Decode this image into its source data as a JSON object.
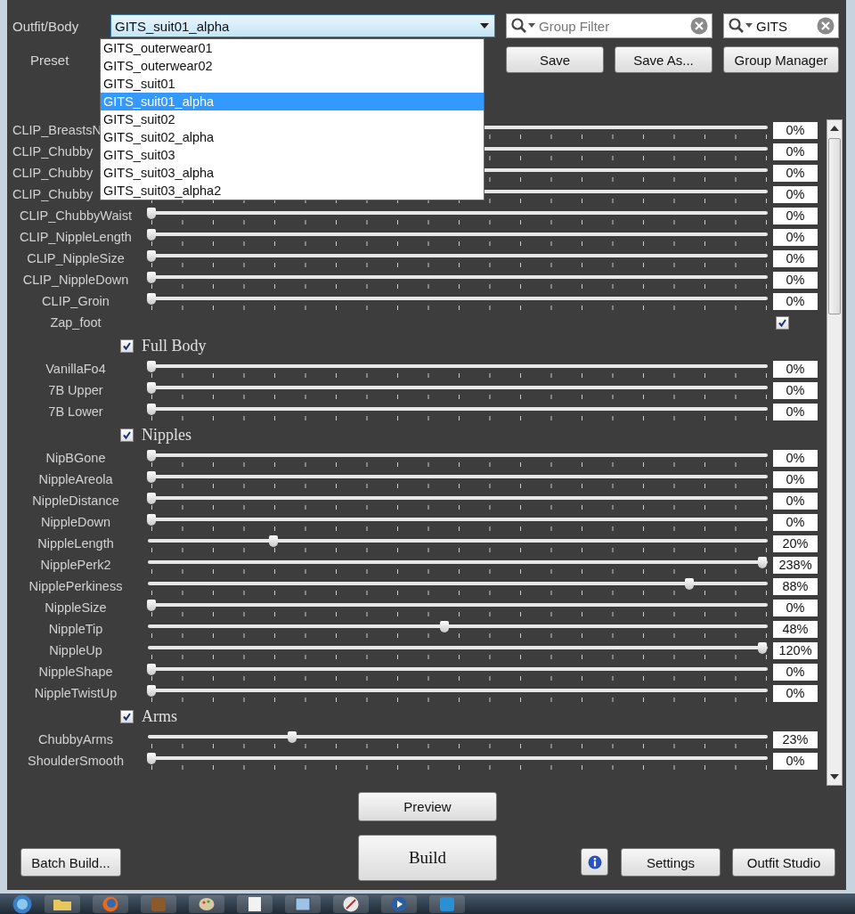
{
  "outfit_body": {
    "label": "Outfit/Body",
    "value": "GITS_suit01_alpha"
  },
  "group_filter": {
    "placeholder": "Group Filter"
  },
  "outfit_filter": {
    "value": "GITS"
  },
  "preset": {
    "label": "Preset"
  },
  "preset_buttons": [
    "Save",
    "Save As...",
    "Group Manager"
  ],
  "dropdown": [
    {
      "label": "GITS_outerwear01",
      "selected": false
    },
    {
      "label": "GITS_outerwear02",
      "selected": false
    },
    {
      "label": "GITS_suit01",
      "selected": false
    },
    {
      "label": "GITS_suit01_alpha",
      "selected": true
    },
    {
      "label": "GITS_suit02",
      "selected": false
    },
    {
      "label": "GITS_suit02_alpha",
      "selected": false
    },
    {
      "label": "GITS_suit03",
      "selected": false
    },
    {
      "label": "GITS_suit03_alpha",
      "selected": false
    },
    {
      "label": "GITS_suit03_alpha2",
      "selected": false
    }
  ],
  "sliders": [
    {
      "kind": "partial",
      "label": "CLIP_BreastsN",
      "level": 0,
      "reading": "0%"
    },
    {
      "kind": "partial",
      "label": "CLIP_Chubby",
      "level": 0,
      "reading": "0%"
    },
    {
      "kind": "partial",
      "label": "CLIP_Chubby",
      "level": 0,
      "reading": "0%"
    },
    {
      "kind": "partial",
      "label": "CLIP_Chubby",
      "level": 0,
      "reading": "0%"
    },
    {
      "kind": "slider",
      "label": "CLIP_ChubbyWaist",
      "level": 0,
      "reading": "0%"
    },
    {
      "kind": "slider",
      "label": "CLIP_NippleLength",
      "level": 0,
      "reading": "0%"
    },
    {
      "kind": "slider",
      "label": "CLIP_NippleSize",
      "level": 0,
      "reading": "0%"
    },
    {
      "kind": "slider",
      "label": "CLIP_NippleDown",
      "level": 0,
      "reading": "0%"
    },
    {
      "kind": "slider",
      "label": "CLIP_Groin",
      "level": 0,
      "reading": "0%"
    },
    {
      "kind": "checkbox",
      "label": "Zap_foot",
      "checked": true
    },
    {
      "kind": "group",
      "label": "Full Body",
      "checked": true
    },
    {
      "kind": "slider",
      "label": "VanillaFo4",
      "level": 0,
      "reading": "0%"
    },
    {
      "kind": "slider",
      "label": "7B Upper",
      "level": 0,
      "reading": "0%"
    },
    {
      "kind": "slider",
      "label": "7B Lower",
      "level": 0,
      "reading": "0%"
    },
    {
      "kind": "group",
      "label": "Nipples",
      "checked": true
    },
    {
      "kind": "slider",
      "label": "NipBGone",
      "level": 0,
      "reading": "0%"
    },
    {
      "kind": "slider",
      "label": "NippleAreola",
      "level": 0,
      "reading": "0%"
    },
    {
      "kind": "slider",
      "label": "NippleDistance",
      "level": 0,
      "reading": "0%"
    },
    {
      "kind": "slider",
      "label": "NippleDown",
      "level": 0,
      "reading": "0%"
    },
    {
      "kind": "slider",
      "label": "NippleLength",
      "level": 0.2,
      "reading": "20%"
    },
    {
      "kind": "slider",
      "label": "NipplePerk2",
      "level": 1,
      "reading": "238%"
    },
    {
      "kind": "slider",
      "label": "NipplePerkiness",
      "level": 0.88,
      "reading": "88%"
    },
    {
      "kind": "slider",
      "label": "NippleSize",
      "level": 0,
      "reading": "0%"
    },
    {
      "kind": "slider",
      "label": "NippleTip",
      "level": 0.48,
      "reading": "48%"
    },
    {
      "kind": "slider",
      "label": "NippleUp",
      "level": 1,
      "reading": "120%"
    },
    {
      "kind": "slider",
      "label": "NippleShape",
      "level": 0,
      "reading": "0%"
    },
    {
      "kind": "slider",
      "label": "NippleTwistUp",
      "level": 0,
      "reading": "0%"
    },
    {
      "kind": "group",
      "label": "Arms",
      "checked": true
    },
    {
      "kind": "slider",
      "label": "ChubbyArms",
      "level": 0.23,
      "reading": "23%"
    },
    {
      "kind": "slider",
      "label": "ShoulderSmooth",
      "level": 0,
      "reading": "0%"
    }
  ],
  "preview_button": "Preview",
  "build_button": "Build",
  "batch_build_button": "Batch Build...",
  "settings_button": "Settings",
  "outfit_studio_button": "Outfit Studio"
}
